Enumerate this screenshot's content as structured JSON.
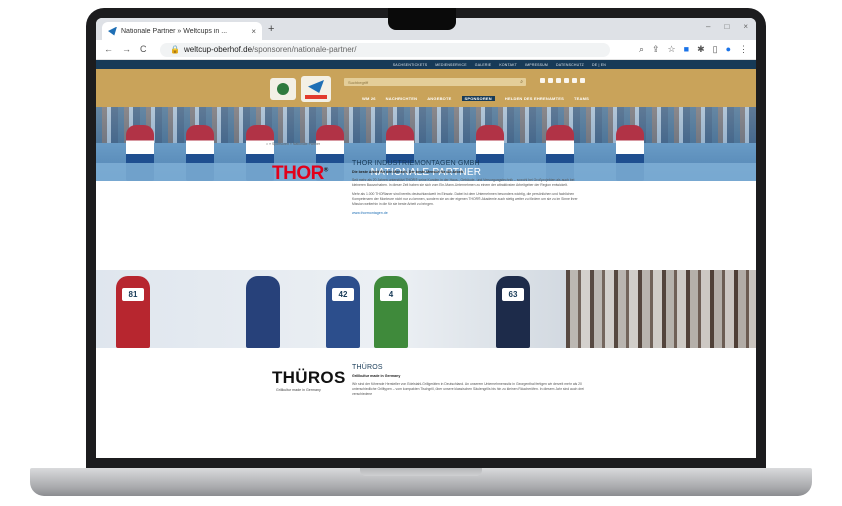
{
  "browser": {
    "tab_title": "Nationale Partner » Weltcups in ...",
    "tab_close": "×",
    "new_tab": "+",
    "nav": {
      "back": "←",
      "forward": "→",
      "reload": "C"
    },
    "url_host": "weltcup-oberhof.de",
    "url_path": "/sponsoren/nationale-partner/",
    "window_controls": {
      "minimize": "–",
      "maximize": "□",
      "close": "×"
    }
  },
  "site": {
    "topbar_links": [
      "SACHSENTICKETS",
      "MEDIENSERVICE",
      "GALERIE",
      "KONTAKT",
      "IMPRESSUM",
      "DATENSCHUTZ",
      "DE | EN"
    ],
    "search_placeholder": "Suchbegriff",
    "menu": [
      "WM 26",
      "NACHRICHTEN",
      "ANGEBOTE",
      "SPONSOREN",
      "HELDEN DES EHRENAMTES",
      "TEAMS"
    ],
    "menu_active_index": 3,
    "hero_title": "NATIONALE PARTNER",
    "breadcrumb": "⌂ » Sponsoren » Nationale Partner",
    "partners": [
      {
        "logo_text": "THOR",
        "title": "THOR INDUSTRIEMONTAGEN GMBH",
        "subtitle": "Die beste Arbeit für den Mensch. Der beste Mensch für die Arbeit.",
        "body1": "Seit mehr als 20 Jahren unterstützt THOR® seine Kunden in der Haus-, Gebäude- und Versorgungstechnik – sowohl bei Großprojekten als auch bei kleineren Bauvorhaben. In dieser Zeit haben sie sich vom Ein-Mann-Unternehmen zu einem der attraktivsten Arbeitgeber der Region entwickelt.",
        "body2": "Mehr als 1.000 THORianer sind bereits deutschlandweit im Einsatz. Dabei ist dem Unternehmen besonders wichtig, die persönlichen und fachlichen Kompetenzen der Monteure nicht nur zu kennen, sondern sie an der eigenen THOR®-Akademie auch stetig weiter zu fördern um sie zu im Sinne ihrer Mission weiterhin in die für sie beste Arbeit zu bringen.",
        "link": "www.thormontagen.de"
      },
      {
        "logo_text": "THÜROS",
        "logo_tagline": "Grillkultur made in Germany",
        "title": "THÜROS",
        "subtitle": "Grillkultur made in Germany",
        "body1": "Wir sind der führende Hersteller von Edelstahl-Grillgeräten in Deutschland. An unserem Unternehmenssitz in Georgenthal fertigen wir derzeit mehr als 20 unterschiedliche Grilltypen – vom kompakten Tischgrill, über unsere klassischen Säulengrills bis hin zu kleinen Räucheröfen. In diesem Jahr sind auch drei verschiedene"
      }
    ],
    "band_bibs": [
      "81",
      "42",
      "4",
      "63"
    ]
  },
  "colors": {
    "navy": "#173a57",
    "gold": "#c9a35a",
    "thor_red": "#e2001a"
  }
}
